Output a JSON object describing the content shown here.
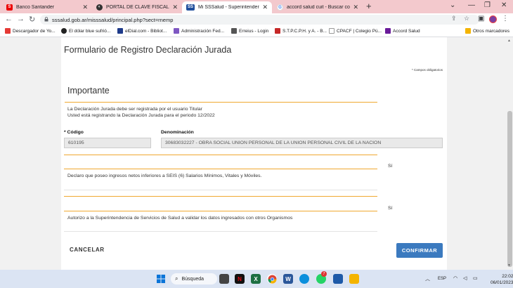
{
  "browser": {
    "tabs": [
      {
        "title": "Banco Santander",
        "favicon": "santander-icon",
        "color": "#ec0000"
      },
      {
        "title": "PORTAL DE CLAVE FISCAL",
        "favicon": "afip-icon",
        "color": "#333333"
      },
      {
        "title": "Mi SSSalud - Superintendencia d",
        "favicon": "sss-icon",
        "color": "#1f4e9c"
      },
      {
        "title": "accord salud cuit - Buscar con G",
        "favicon": "google-icon",
        "color": "#4285f4"
      }
    ],
    "url": "sssalud.gob.ar/misssalud/principal.php?sect=rnemp",
    "bookmarks": [
      "Descargador de Yo...",
      "El dólar blue sufrió...",
      "elDial.com - Bibliot...",
      "Administración Fed...",
      "Erreius - Login",
      "S.T.P.C.P.H. y A. - B...",
      "CPACF | Colegio Pú...",
      "Accord Salud",
      "Otros marcadores"
    ]
  },
  "form": {
    "title": "Formulario de Registro Declaración Jurada",
    "required_note": "* Campos obligatorios",
    "section_title": "Importante",
    "info_line1": "La Declaración Jurada debe ser registrada por el usuario Titular",
    "info_line2": "Usted está registrando la Declaración Jurada para el periodo 12/2022",
    "codigo_label": "* Código",
    "codigo_value": "610195",
    "denominacion_label": "Denominación",
    "denominacion_value": "30683032227 - OBRA SOCIAL UNION PERSONAL DE LA UNION PERSONAL CIVIL DE LA NACION",
    "decl1_answer": "Sí",
    "decl1_text": "Declaro que poseo ingresos netos inferiores a SEIS (6) Salarios Mínimos, Vitales y Móviles.",
    "decl2_answer": "Sí",
    "decl2_text": "Autorizo a la Superintendencia de Servicios de Salud a validar los datos ingresados con otros Organismos",
    "cancel_label": "CANCELAR",
    "confirm_label": "CONFIRMAR"
  },
  "taskbar": {
    "search_label": "Búsqueda",
    "lang": "ESP",
    "time": "22:02",
    "date": "06/01/2023",
    "whatsapp_badge": "7"
  }
}
